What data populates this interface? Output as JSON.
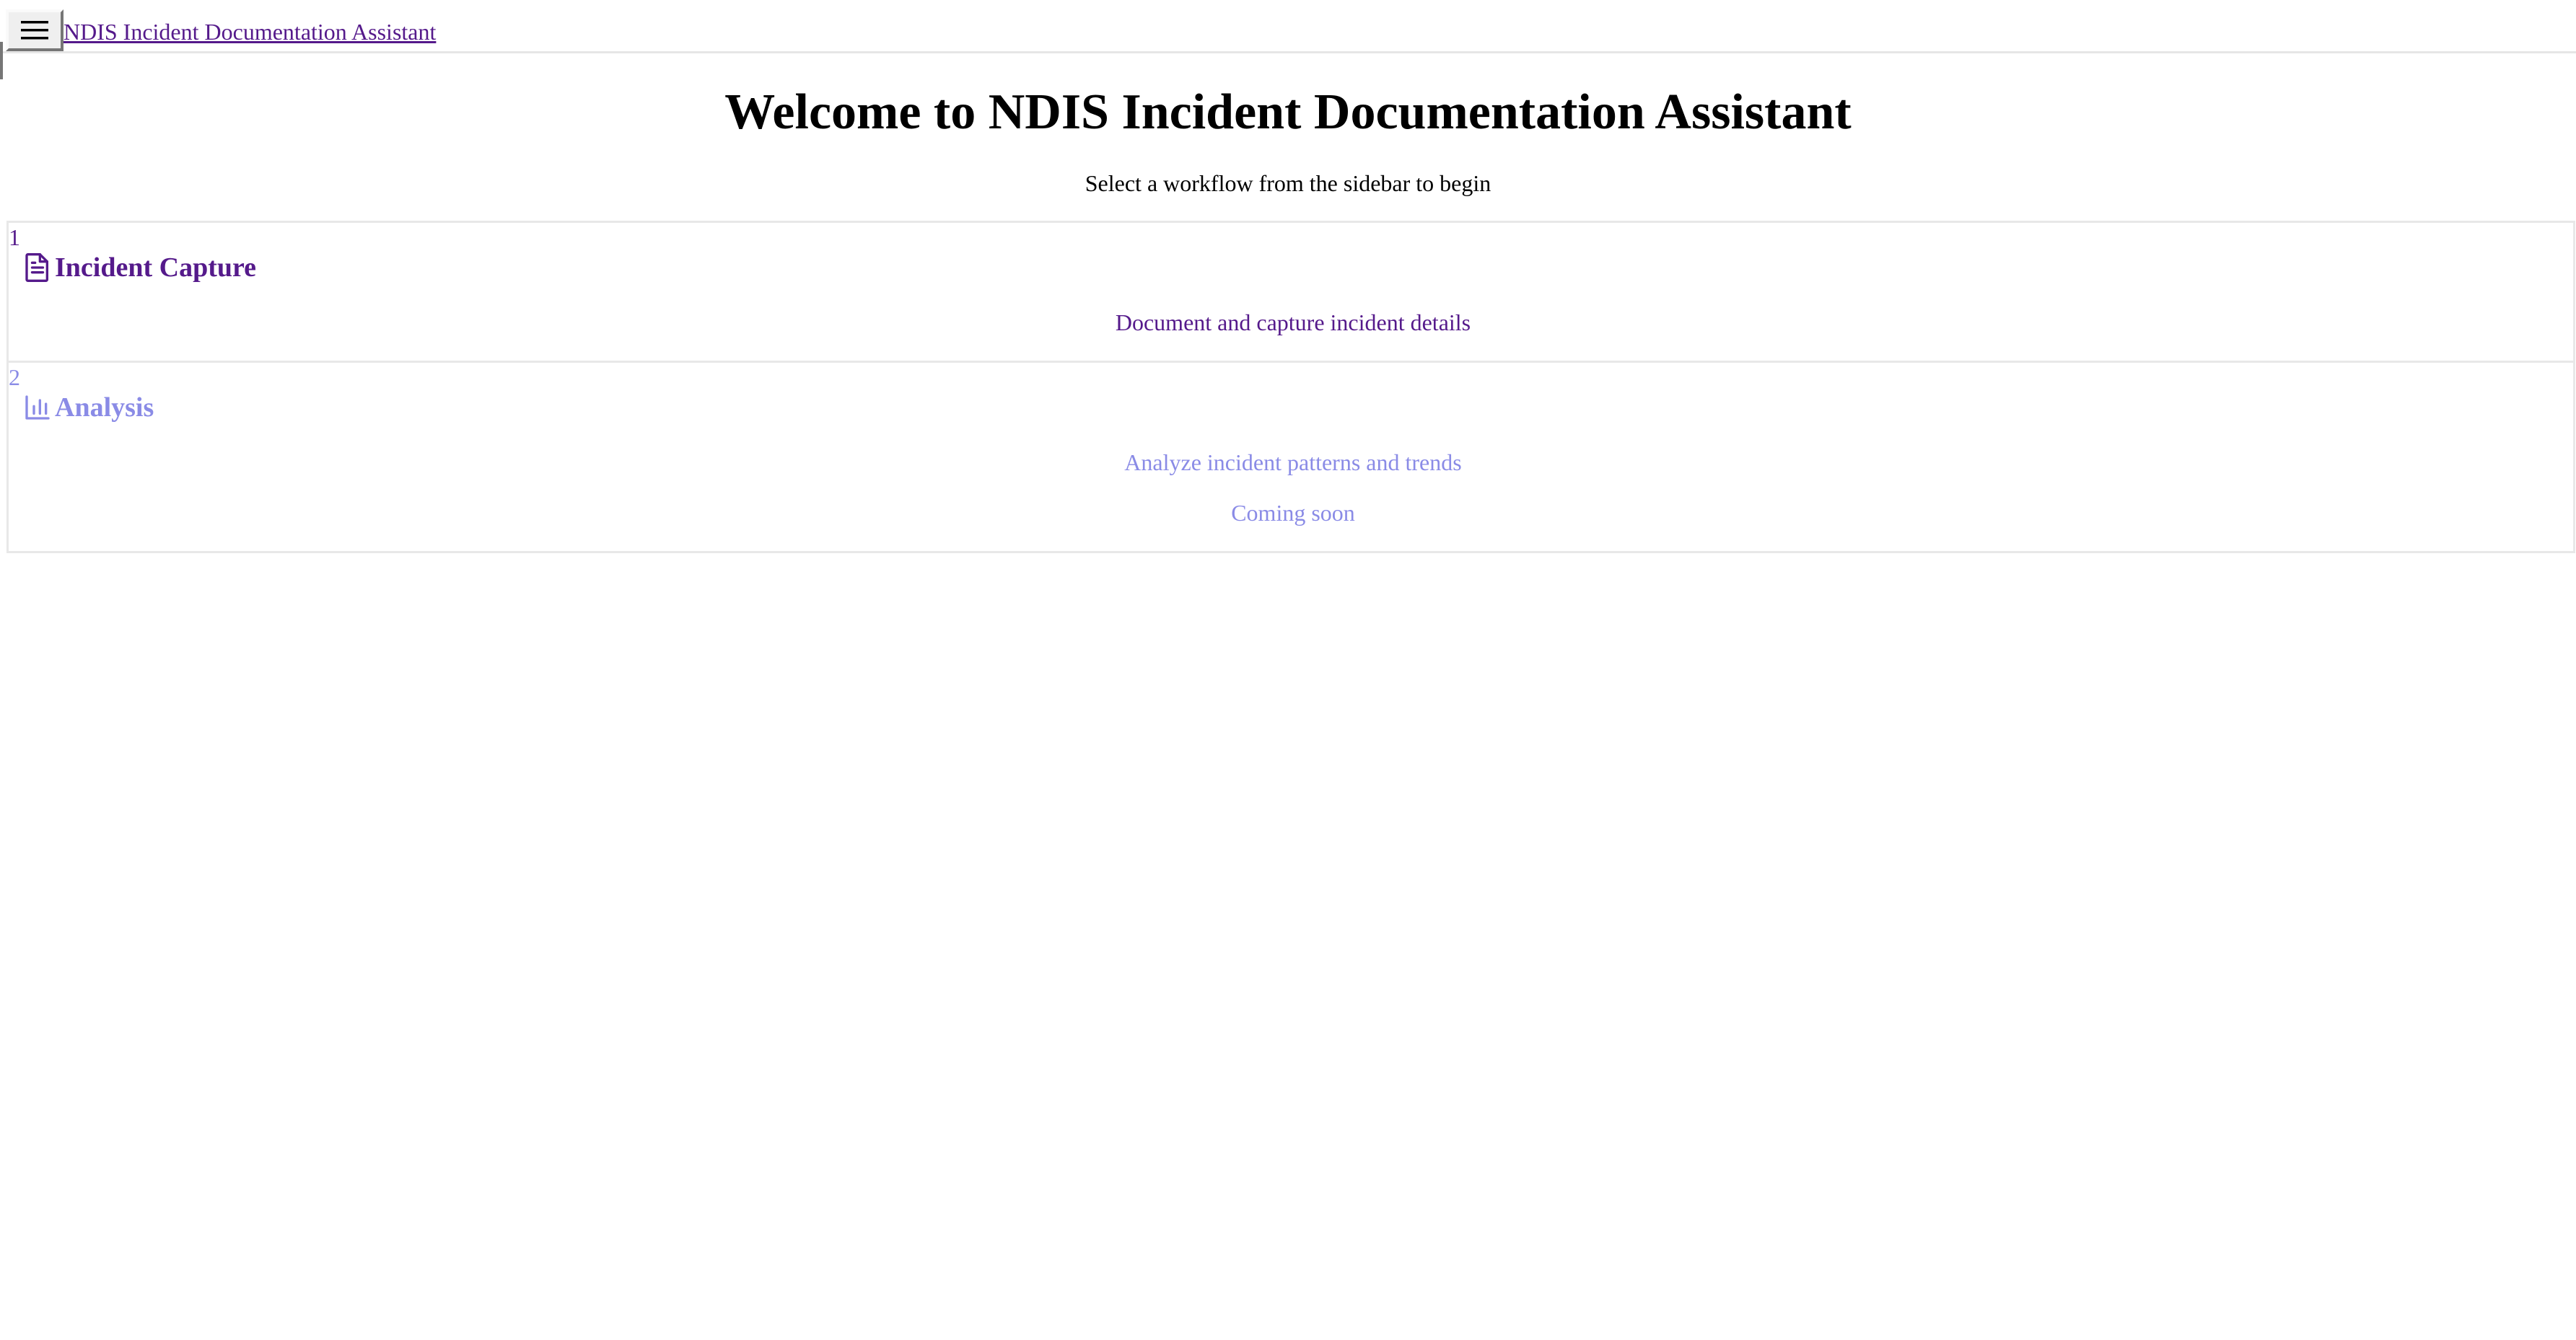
{
  "header": {
    "menu_icon": "hamburger-menu-icon",
    "app_title": "NDIS Incident Documentation Assistant"
  },
  "main": {
    "heading": "Welcome to NDIS Incident Documentation Assistant",
    "subtitle": "Select a workflow from the sidebar to begin"
  },
  "workflows": [
    {
      "number": "1",
      "icon": "document-icon",
      "title": "Incident Capture",
      "description": "Document and capture incident details",
      "status": "",
      "color": "#551a8b"
    },
    {
      "number": "2",
      "icon": "bar-chart-icon",
      "title": "Analysis",
      "description": "Analyze incident patterns and trends",
      "status": "Coming soon",
      "color": "#8a8be6"
    }
  ]
}
